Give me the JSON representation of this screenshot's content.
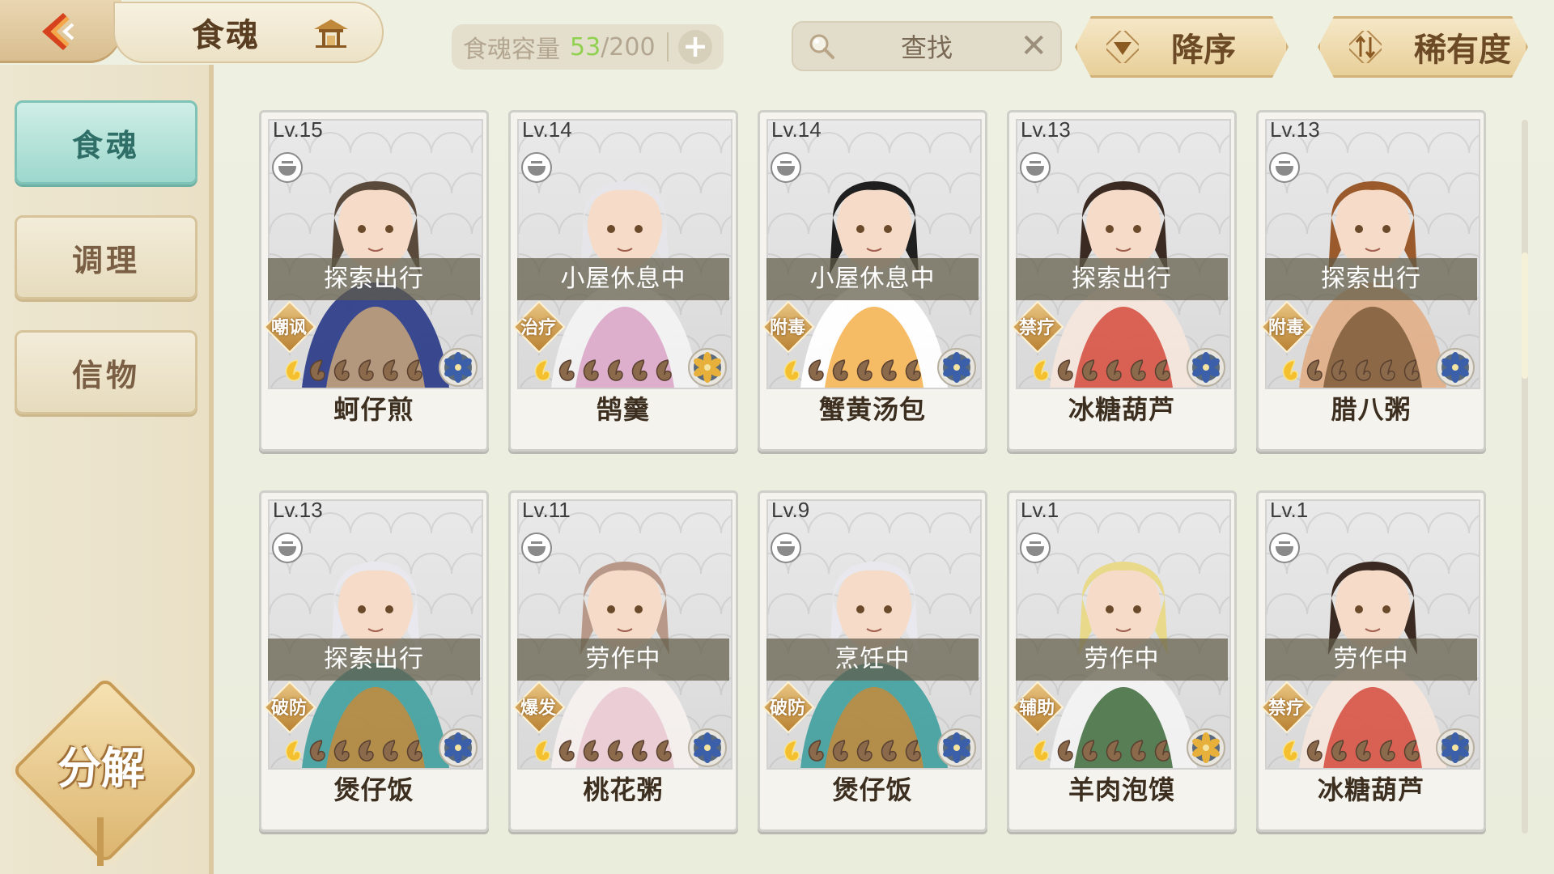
{
  "header": {
    "title": "食魂",
    "capacity_label": "食魂容量",
    "capacity_current": "53",
    "capacity_max": "/200",
    "add_label": "+",
    "search_placeholder": "查找",
    "clear_label": "✕",
    "sort_order_label": "降序",
    "sort_key_label": "稀有度"
  },
  "sidebar": {
    "items": [
      {
        "label": "食魂",
        "active": true
      },
      {
        "label": "调理",
        "active": false
      },
      {
        "label": "信物",
        "active": false
      }
    ],
    "decompose_label": "分解"
  },
  "colors": {
    "accent_teal": "#9dd8cd",
    "gold": "#dcb56f",
    "capacity_green": "#8fd14f"
  },
  "cards": [
    {
      "level": "Lv.15",
      "status": "探索出行",
      "role": "嘲讽",
      "name": "蚵仔煎",
      "stars": 5,
      "element": "blue-flower-icon"
    },
    {
      "level": "Lv.14",
      "status": "小屋休息中",
      "role": "治疗",
      "name": "鹄羹",
      "stars": 5,
      "element": "gold-flower-icon"
    },
    {
      "level": "Lv.14",
      "status": "小屋休息中",
      "role": "附毒",
      "name": "蟹黄汤包",
      "stars": 5,
      "element": "blue-flower-icon"
    },
    {
      "level": "Lv.13",
      "status": "探索出行",
      "role": "禁疗",
      "name": "冰糖葫芦",
      "stars": 5,
      "element": "blue-flower-icon"
    },
    {
      "level": "Lv.13",
      "status": "探索出行",
      "role": "附毒",
      "name": "腊八粥",
      "stars": 5,
      "element": "blue-flower-icon"
    },
    {
      "level": "Lv.13",
      "status": "探索出行",
      "role": "破防",
      "name": "煲仔饭",
      "stars": 5,
      "element": "blue-flower-icon"
    },
    {
      "level": "Lv.11",
      "status": "劳作中",
      "role": "爆发",
      "name": "桃花粥",
      "stars": 5,
      "element": "blue-flower-icon"
    },
    {
      "level": "Lv.9",
      "status": "烹饪中",
      "role": "破防",
      "name": "煲仔饭",
      "stars": 5,
      "element": "blue-flower-icon"
    },
    {
      "level": "Lv.1",
      "status": "劳作中",
      "role": "辅助",
      "name": "羊肉泡馍",
      "stars": 5,
      "element": "gold-flower-icon"
    },
    {
      "level": "Lv.1",
      "status": "劳作中",
      "role": "禁疗",
      "name": "冰糖葫芦",
      "stars": 5,
      "element": "blue-flower-icon"
    }
  ]
}
